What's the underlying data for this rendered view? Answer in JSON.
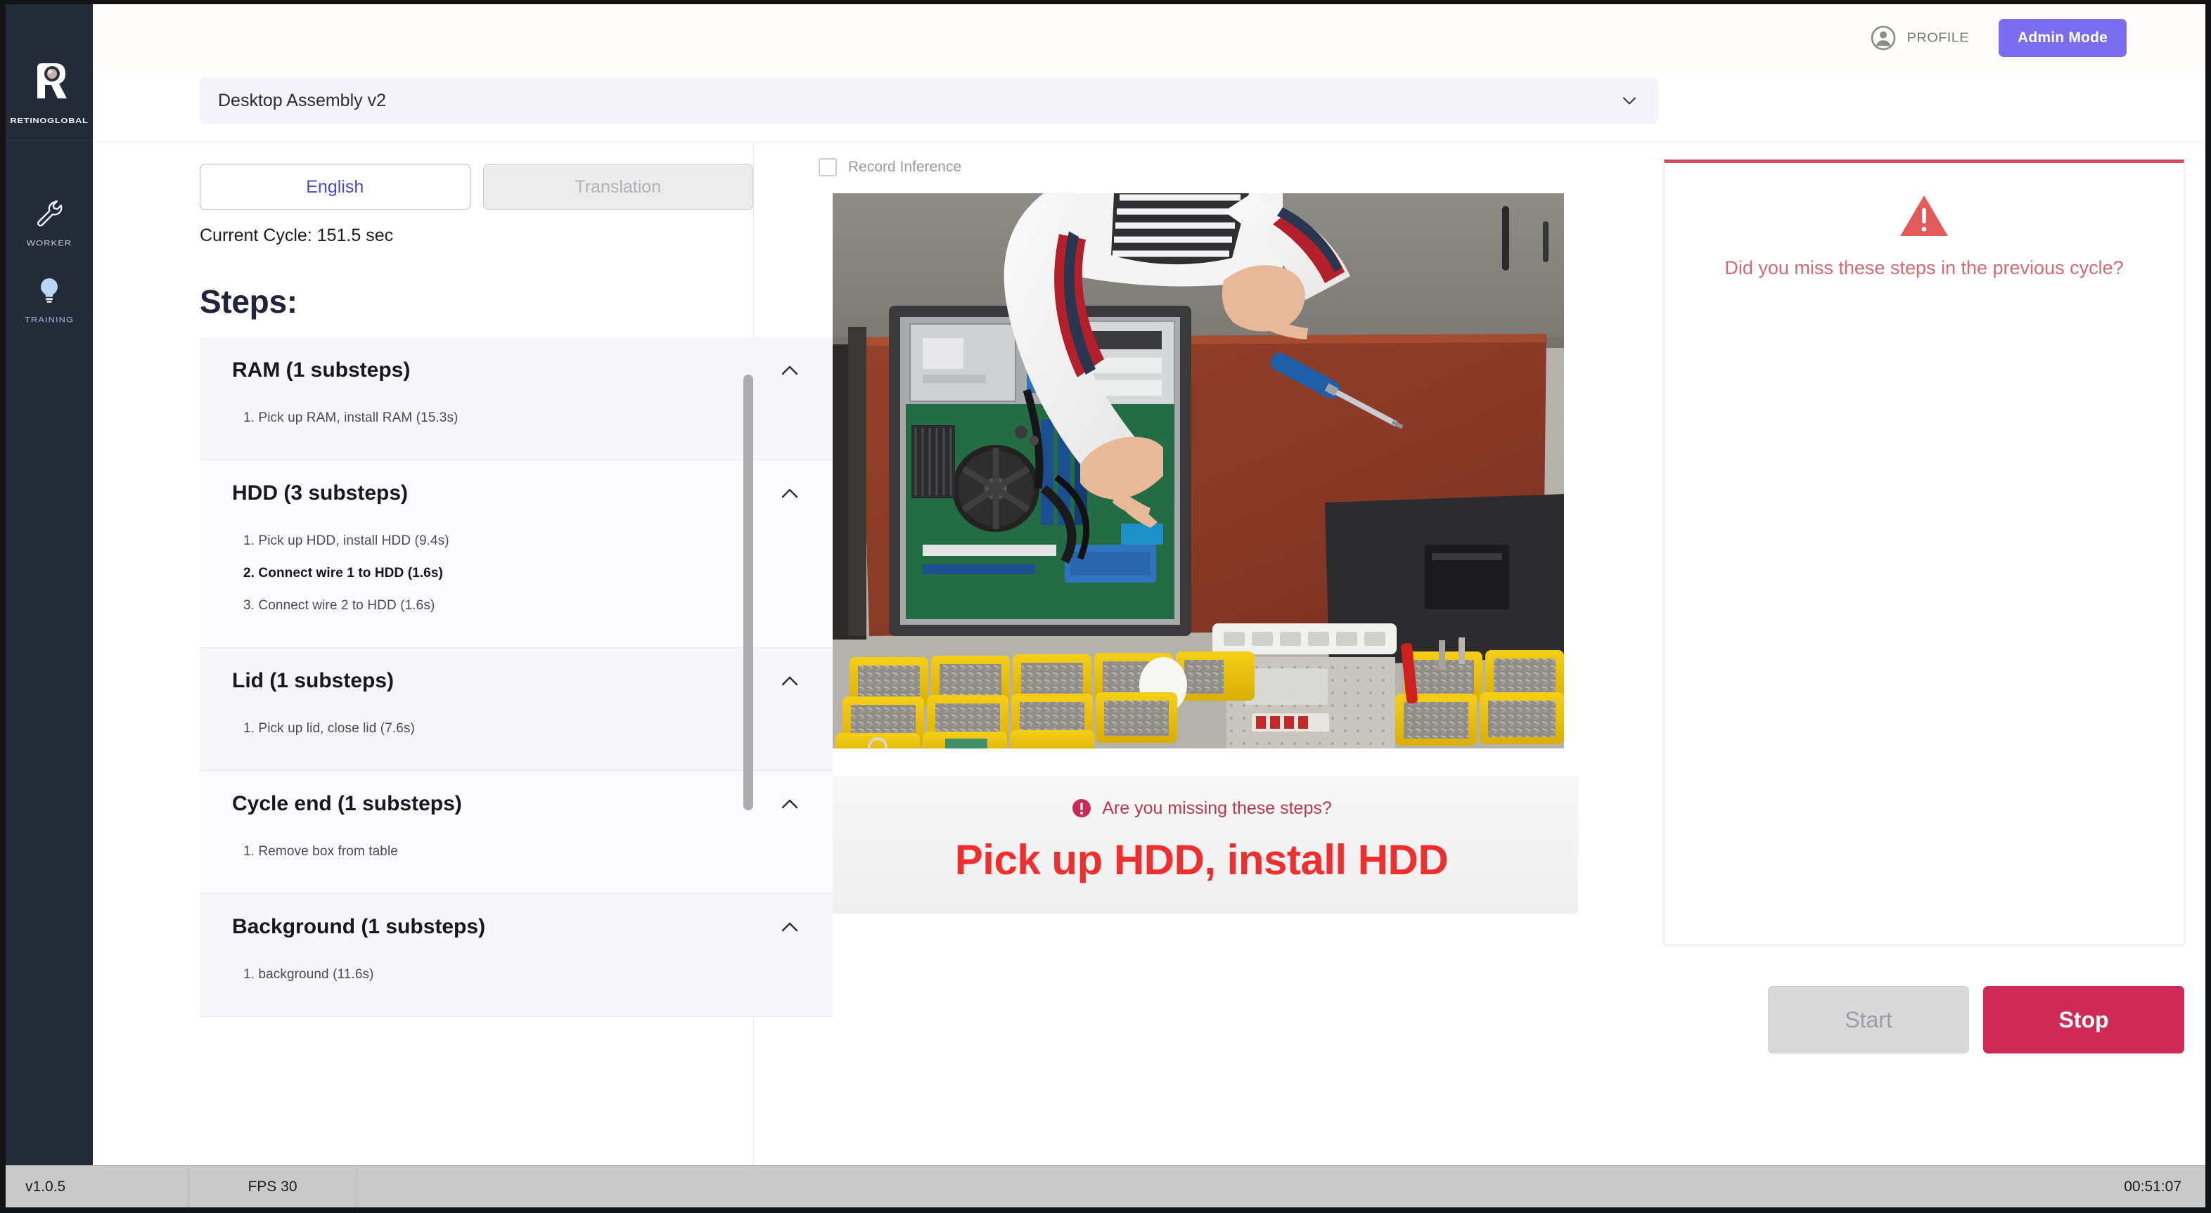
{
  "brand": {
    "name": "RETINOGLOBAL",
    "logo_icon": "r-logo-icon"
  },
  "sidebar": {
    "items": [
      {
        "label": "WORKER",
        "icon": "wrench-icon"
      },
      {
        "label": "TRAINING",
        "icon": "lightbulb-icon"
      }
    ]
  },
  "header": {
    "profile_label": "PROFILE",
    "profile_icon": "account-circle-icon",
    "admin_button": "Admin Mode",
    "admin_button_color": "#7b6cf0"
  },
  "task_select": {
    "value": "Desktop Assembly v2",
    "caret_icon": "chevron-down-icon"
  },
  "language_tabs": [
    {
      "label": "English",
      "active": true
    },
    {
      "label": "Translation",
      "active": false
    }
  ],
  "cycle": {
    "text": "Current Cycle: 151.5 sec"
  },
  "steps_panel": {
    "title": "Steps:",
    "groups": [
      {
        "name": "RAM (1 substeps)",
        "chevron": "chevron-up-icon",
        "substeps": [
          {
            "text": "1. Pick up RAM, install RAM (15.3s)",
            "active": false
          }
        ]
      },
      {
        "name": "HDD (3 substeps)",
        "chevron": "chevron-up-icon",
        "substeps": [
          {
            "text": "1. Pick up HDD, install HDD (9.4s)",
            "active": false
          },
          {
            "text": "2. Connect wire 1 to HDD (1.6s)",
            "active": true
          },
          {
            "text": "3. Connect wire 2 to HDD (1.6s)",
            "active": false
          }
        ]
      },
      {
        "name": "Lid (1 substeps)",
        "chevron": "chevron-up-icon",
        "substeps": [
          {
            "text": "1. Pick up lid, close lid (7.6s)",
            "active": false
          }
        ]
      },
      {
        "name": "Cycle end (1 substeps)",
        "chevron": "chevron-up-icon",
        "substeps": [
          {
            "text": "1. Remove box from table",
            "active": false
          }
        ]
      },
      {
        "name": "Background (1 substeps)",
        "chevron": "chevron-up-icon",
        "substeps": [
          {
            "text": "1. background (11.6s)",
            "active": false
          }
        ]
      }
    ]
  },
  "center": {
    "record_inference_label": "Record Inference",
    "record_inference_checked": false,
    "video_caption": "overhead view of worker assembling desktop PC at workbench with yellow parts bins"
  },
  "alert_banner": {
    "icon": "alert-circle-icon",
    "subtitle": "Are you missing these steps?",
    "message": "Pick up HDD, install HDD",
    "accent_color": "#cf2a4e",
    "message_color": "#ef2f2f"
  },
  "warning_panel": {
    "icon": "warning-triangle-icon",
    "text": "Did you miss these steps in the previous cycle?",
    "accent_color": "#cf4e62"
  },
  "actions": {
    "start_label": "Start",
    "start_disabled": true,
    "stop_label": "Stop",
    "stop_color": "#cf2a57"
  },
  "statusbar": {
    "version": "v1.0.5",
    "fps": "FPS 30",
    "clock": "00:51:07"
  }
}
